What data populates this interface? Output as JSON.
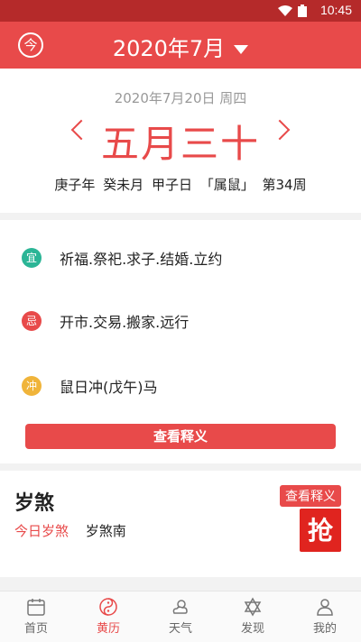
{
  "status": {
    "time": "10:45"
  },
  "header": {
    "today_label": "今",
    "month_title": "2020年7月"
  },
  "date": {
    "gregorian": "2020年7月20日  周四",
    "lunar": "五月三十",
    "ganzhi": "庚子年 癸未月 甲子日 「属鼠」 第34周"
  },
  "yiji": {
    "yi": {
      "badge": "宜",
      "text": "祈福.祭祀.求子.结婚.立约",
      "color": "#2bb596"
    },
    "ji": {
      "badge": "忌",
      "text": "开市.交易.搬家.远行",
      "color": "#e84a4a"
    },
    "chong": {
      "badge": "冲",
      "text": "鼠日冲(戊午)马",
      "color": "#f0b43a"
    },
    "explain_button": "查看释义"
  },
  "suisha": {
    "title": "岁煞",
    "key": "今日岁煞",
    "value": "岁煞南",
    "explain_tag": "查看释义",
    "promo_char": "抢"
  },
  "tabs": [
    {
      "label": "首页",
      "icon": "calendar-icon"
    },
    {
      "label": "黄历",
      "icon": "taiji-icon",
      "active": true
    },
    {
      "label": "天气",
      "icon": "weather-icon"
    },
    {
      "label": "发现",
      "icon": "star-icon"
    },
    {
      "label": "我的",
      "icon": "person-icon"
    }
  ],
  "colors": {
    "primary": "#e84a4a",
    "status_bar": "#b52a2a"
  }
}
